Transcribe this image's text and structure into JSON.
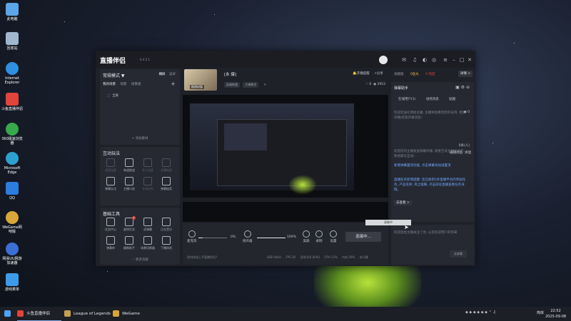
{
  "desktop": {
    "icons": [
      {
        "label": "此电脑",
        "color": "#5aa6e8"
      },
      {
        "label": "回收站",
        "color": "#9fb7cc"
      },
      {
        "label": "Internet Explorer",
        "color": "#2f8fe0"
      },
      {
        "label": "斗鱼直播伴侣",
        "color": "#e0443a"
      },
      {
        "label": "360极速浏览器",
        "color": "#38a84b"
      },
      {
        "label": "Microsoft Edge",
        "color": "#2ea0cf"
      },
      {
        "label": "QQ",
        "color": "#2b7de0"
      },
      {
        "label": "WeGame网吧版",
        "color": "#d9a63a"
      },
      {
        "label": "网易UU网游加速器",
        "color": "#3c6fd6"
      },
      {
        "label": "游戏菜单",
        "color": "#3d9be9"
      }
    ]
  },
  "app": {
    "title": "直播伴侣",
    "version": "6.4.5.1",
    "title_icons": [
      "message-icon",
      "headset-icon",
      "skin-icon",
      "community-icon"
    ],
    "left": {
      "mode_label": "常规模式 ▼",
      "mode_tabs": [
        "横屏",
        "竖屏"
      ],
      "scene_tabs": [
        "我的场景",
        "场景",
        "场景组"
      ],
      "source_item": "全屏",
      "add_source": "+ 添加素材",
      "interaction": {
        "title": "互动玩法",
        "items": [
          {
            "label": "语音连麦",
            "enabled": false
          },
          {
            "label": "神战挑战",
            "enabled": true
          },
          {
            "label": "多人连麦",
            "enabled": false
          },
          {
            "label": "主播连麦",
            "enabled": false
          },
          {
            "label": "弹幕玩法",
            "enabled": true
          },
          {
            "label": "主播口说",
            "enabled": true
          },
          {
            "label": "主动计时",
            "enabled": false
          },
          {
            "label": "弹幕抽奖",
            "enabled": true
          }
        ]
      },
      "tools": {
        "title": "基础工具",
        "items": [
          {
            "label": "任务中心",
            "badge": ""
          },
          {
            "label": "星探任务",
            "badge": "1"
          },
          {
            "label": "读弹幕",
            "badge": ""
          },
          {
            "label": "正在音乐",
            "badge": ""
          },
          {
            "label": "弹幕库",
            "badge": ""
          },
          {
            "label": "摄像助手",
            "badge": ""
          },
          {
            "label": "场景切换器",
            "badge": ""
          },
          {
            "label": "下播体验",
            "badge": ""
          }
        ]
      },
      "more": "··· 更多功能"
    },
    "center": {
      "thumb_label": "修改封面",
      "room_title": "[永 爆]",
      "categories": [
        "英雄联盟",
        "大神教学"
      ],
      "open_remind": "开播提醒",
      "share": "分享",
      "likes": "0",
      "viewers": "2953",
      "recording_text": "录制中",
      "controls": {
        "mic_label": "麦克风",
        "mic_pct": "0%",
        "mic_level": 0.15,
        "speaker_label": "扬声器",
        "speaker_pct": "100%",
        "speaker_level": 1.0,
        "beauty": "美颜",
        "record": "录制",
        "settings": "设置",
        "go_live": "连接中...",
        "tip": "如何快速上手直播伴侣?",
        "status": [
          "码率:0kb/s",
          "FPS:30",
          "丢帧:0(0.00%)",
          "CPU:13%",
          "内存:26%",
          "未开播"
        ]
      }
    },
    "right": {
      "tabs": [
        "贡献值",
        "0鱼丸"
      ],
      "red_tag": "0 热度",
      "detail_btn": "详情 >",
      "danmu_title": "弹幕助手",
      "danmu_tabs": [
        "在线用户(1)",
        "进场消息",
        "贴图"
      ],
      "msg1": "欢迎您送礼物给主播, 主播将会看到您的支持, 更新开播/结束开播消息!",
      "viewer_count": "0",
      "msg2": "欢迎您向主播发送弹幕开播, 或者告诉主播发送的, 和他聊天互动!",
      "online_count": "0条(人)",
      "edit_links": [
        "编辑尚品",
        "清理"
      ],
      "new_feature": "新增弹幕置顶功能, 点击弹幕添加进置顶",
      "task_notice": "直播任务新增提醒: 您已收到1条直播平台的奖励任务, 产品名称: 风之殿舞, 点击前往直播查看任务详情。",
      "go_see": "去查看 >",
      "bottom_msg": "欢迎您给主播关注了你, 以及欢迎用户的到来",
      "bottom_btn": "去查看"
    }
  },
  "taskbar": {
    "items": [
      {
        "label": "斗鱼直播伴侣",
        "color": "#e0443a"
      },
      {
        "label": "League of Legends",
        "color": "#c8a050"
      },
      {
        "label": "WeGame",
        "color": "#d9a63a"
      }
    ],
    "tray": [
      "英",
      "⌃",
      "♫",
      "⊞"
    ],
    "lang": "简体",
    "time": "22:52",
    "date": "2025-09-08"
  }
}
